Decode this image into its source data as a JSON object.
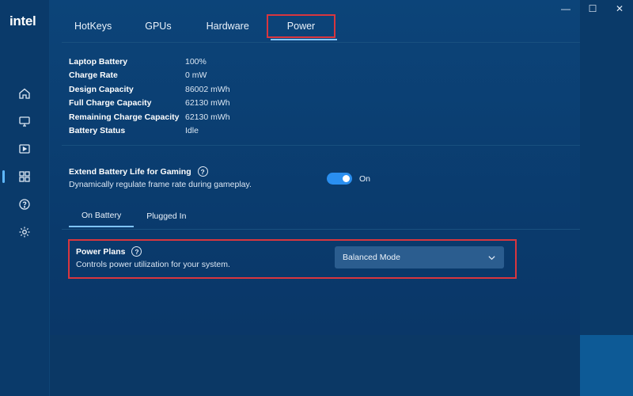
{
  "app": {
    "logo": "intel"
  },
  "window_controls": {
    "minimize": "—",
    "maximize": "☐",
    "close": "✕"
  },
  "sidebar": {
    "items": [
      {
        "name": "home-icon"
      },
      {
        "name": "monitor-icon"
      },
      {
        "name": "video-icon"
      },
      {
        "name": "apps-grid-icon",
        "active": true
      },
      {
        "name": "help-icon"
      },
      {
        "name": "settings-gear-icon"
      }
    ]
  },
  "tabs": [
    {
      "label": "HotKeys"
    },
    {
      "label": "GPUs"
    },
    {
      "label": "Hardware"
    },
    {
      "label": "Power",
      "active": true
    }
  ],
  "battery": {
    "rows": [
      {
        "label": "Laptop Battery",
        "value": "100%"
      },
      {
        "label": "Charge Rate",
        "value": "0 mW"
      },
      {
        "label": "Design Capacity",
        "value": "86002 mWh"
      },
      {
        "label": "Full Charge Capacity",
        "value": "62130 mWh"
      },
      {
        "label": "Remaining Charge Capacity",
        "value": "62130 mWh"
      },
      {
        "label": "Battery Status",
        "value": "Idle"
      }
    ]
  },
  "extend_battery": {
    "title": "Extend Battery Life for Gaming",
    "help": "?",
    "description": "Dynamically regulate frame rate during gameplay.",
    "toggle_on": true,
    "toggle_label": "On"
  },
  "subtabs": [
    {
      "label": "On Battery",
      "active": true
    },
    {
      "label": "Plugged In"
    }
  ],
  "power_plans": {
    "title": "Power Plans",
    "help": "?",
    "description": "Controls power utilization for your system.",
    "selected": "Balanced Mode"
  },
  "colors": {
    "accent": "#2a8ff0",
    "highlight_box": "#d9363e",
    "background": "#0a3a6c"
  }
}
